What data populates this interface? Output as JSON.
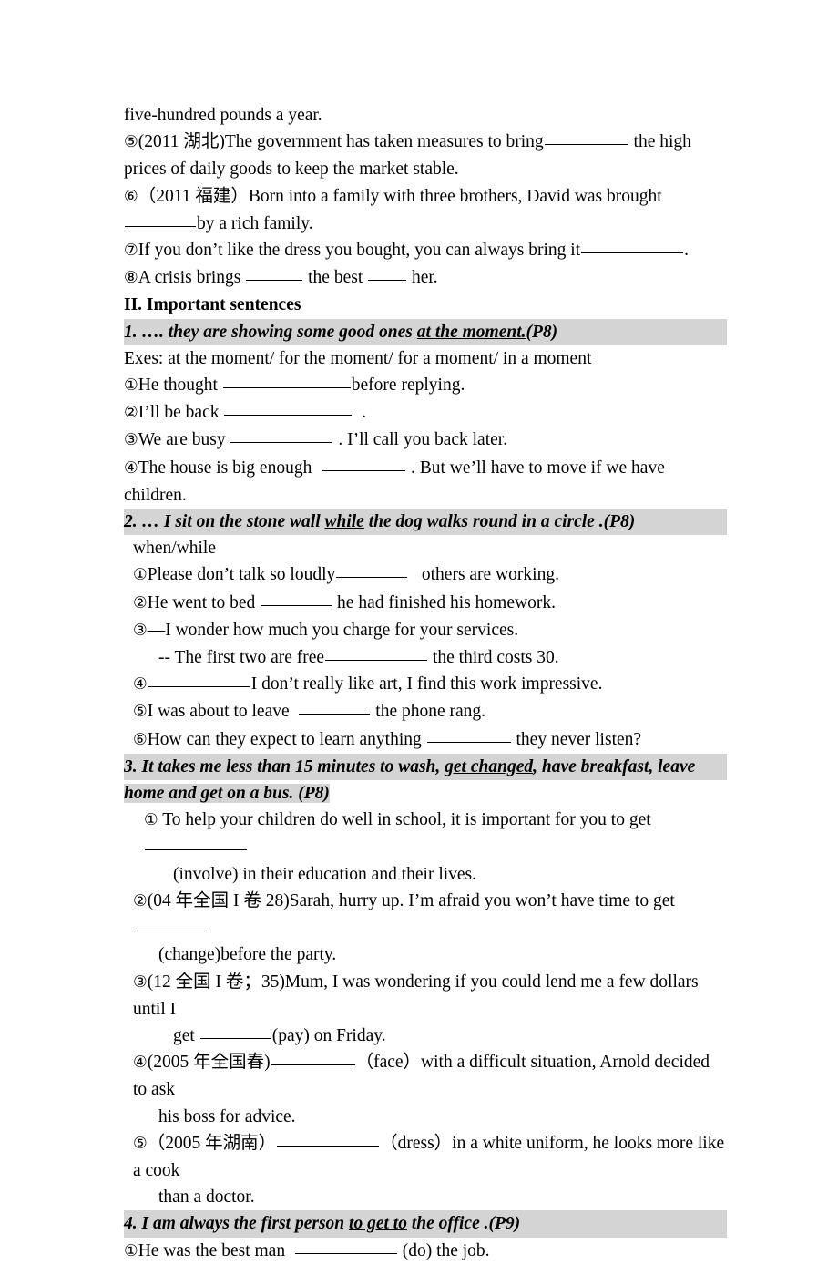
{
  "document": {
    "lines": {
      "l1": "five-hundred pounds a year.",
      "l2_num": "⑤",
      "l2_a": "(2011 湖北)The government has taken measures to bring",
      "l2_b": "the high prices of daily goods to keep the market stable.",
      "l3_num": "⑥",
      "l3_a": "（2011 福建）Born into a family with three brothers, David was brought",
      "l3_b": "by a rich family.",
      "l4_num": "⑦",
      "l4_a": "If you don’t like the dress you bought, you can always bring it",
      "l4_b": ".",
      "l5_num": "⑧",
      "l5_a": "A crisis brings",
      "l5_b": "the best",
      "l5_c": "her."
    },
    "section_heading": "II. Important sentences",
    "items": [
      {
        "id": "s1",
        "heading_prefix": "1. …. they are showing some good ones ",
        "heading_underlined": "at the moment.",
        "heading_suffix": "(P8)",
        "exes": "Exes: at the moment/ for the moment/ for a moment/ in a moment",
        "questions": [
          {
            "num": "①",
            "a": "He thought",
            "b": "before replying."
          },
          {
            "num": "②",
            "a": "I’ll be back",
            "b": "."
          },
          {
            "num": "③",
            "a": "We are busy",
            "b": ". I’ll call you back later."
          },
          {
            "num": "④",
            "a": "The house is big enough",
            "b": ". But we’ll have to move if we have children."
          }
        ]
      },
      {
        "id": "s2",
        "heading_prefix": "2. … I sit on the stone wall ",
        "heading_underlined": "while",
        "heading_suffix": " the dog walks round in a circle .(P8)",
        "note": "when/while",
        "questions": [
          {
            "num": "①",
            "a": "Please don’t talk so loudly",
            "b": "others are working."
          },
          {
            "num": "②",
            "a": "He went to bed",
            "b": "he had finished his homework."
          },
          {
            "num": "③",
            "a": "—I wonder how much you charge for your services.",
            "b": ""
          },
          {
            "num": "",
            "a": "-- The first two are free",
            "b": "the third costs 30."
          },
          {
            "num": "④",
            "a": "",
            "b": "I don’t really like art, I find this work impressive."
          },
          {
            "num": "⑤",
            "a": "I was about to leave",
            "b": "the phone rang."
          },
          {
            "num": "⑥",
            "a": "How can they expect to learn anything",
            "b": "they never listen?"
          }
        ]
      },
      {
        "id": "s3",
        "heading_prefix": "3. It takes me less than 15 minutes to wash, ",
        "heading_underlined": "get changed",
        "heading_suffix": ", have breakfast, leave home and get on a bus. (P8)",
        "heading_line1_prefix": "3. It takes me less than 15 minutes to wash, ",
        "heading_line1_underlined": "get changed",
        "heading_line1_suffix": ", have breakfast, leave",
        "heading_line2": "home and get on a bus. (P8)",
        "questions": [
          {
            "num": "①",
            "a": "To help your children do well in school, it is important for you to get",
            "b": "",
            "cont": "(involve) in their education and their lives."
          },
          {
            "num": "②",
            "a": "(04 年全国 I 卷 28)Sarah, hurry up. I’m afraid you won’t have time to get",
            "b": "",
            "cont": "(change)before the party."
          },
          {
            "num": "③",
            "a": "(12 全国 I 卷；35)Mum, I was wondering if you could lend me a few dollars until I",
            "b": "",
            "cont_a": "get",
            "cont_b": "(pay) on Friday."
          },
          {
            "num": "④",
            "a": "(2005 年全国春)",
            "b": "（face）with a difficult situation, Arnold decided to ask",
            "cont": "his boss for advice."
          },
          {
            "num": "⑤",
            "a": "（2005 年湖南）",
            "b": "（dress）in a white uniform, he looks more like a cook",
            "cont": "than a doctor."
          }
        ]
      },
      {
        "id": "s4",
        "heading_prefix": "4. I am always the first person ",
        "heading_underlined": "to get to",
        "heading_suffix": " the office .(P9)",
        "questions": [
          {
            "num": "①",
            "a": "He was the best man",
            "b": "(do) the job."
          }
        ]
      }
    ]
  },
  "colors": {
    "highlight": "#d4d4d4",
    "text": "#000000",
    "background": "#ffffff"
  }
}
